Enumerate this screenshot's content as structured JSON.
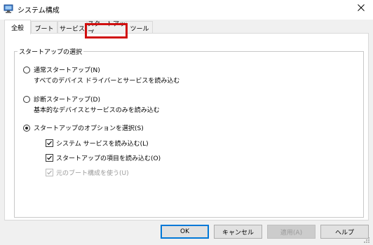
{
  "window": {
    "title": "システム構成"
  },
  "tabs": [
    {
      "label": "全般",
      "selected": true
    },
    {
      "label": "ブート"
    },
    {
      "label": "サービス"
    },
    {
      "label": "スタートアップ",
      "highlighted": true
    },
    {
      "label": "ツール"
    }
  ],
  "startup_selection": {
    "group_title": "スタートアップの選択",
    "normal": {
      "label": "通常スタートアップ(N)",
      "description": "すべてのデバイス ドライバーとサービスを読み込む",
      "selected": false
    },
    "diagnostic": {
      "label": "診断スタートアップ(D)",
      "description": "基本的なデバイスとサービスのみを読み込む",
      "selected": false
    },
    "selective": {
      "label": "スタートアップのオプションを選択(S)",
      "selected": true
    },
    "options": [
      {
        "label": "システム サービスを読み込む(L)",
        "checked": true,
        "enabled": true
      },
      {
        "label": "スタートアップの項目を読み込む(O)",
        "checked": true,
        "enabled": true
      },
      {
        "label": "元のブート構成を使う(U)",
        "checked": true,
        "enabled": false
      }
    ]
  },
  "buttons": {
    "ok": "OK",
    "cancel": "キャンセル",
    "apply": "適用(A)",
    "help": "ヘルプ"
  },
  "colors": {
    "highlight": "#d10f0f",
    "default_button_border": "#0078d7"
  }
}
